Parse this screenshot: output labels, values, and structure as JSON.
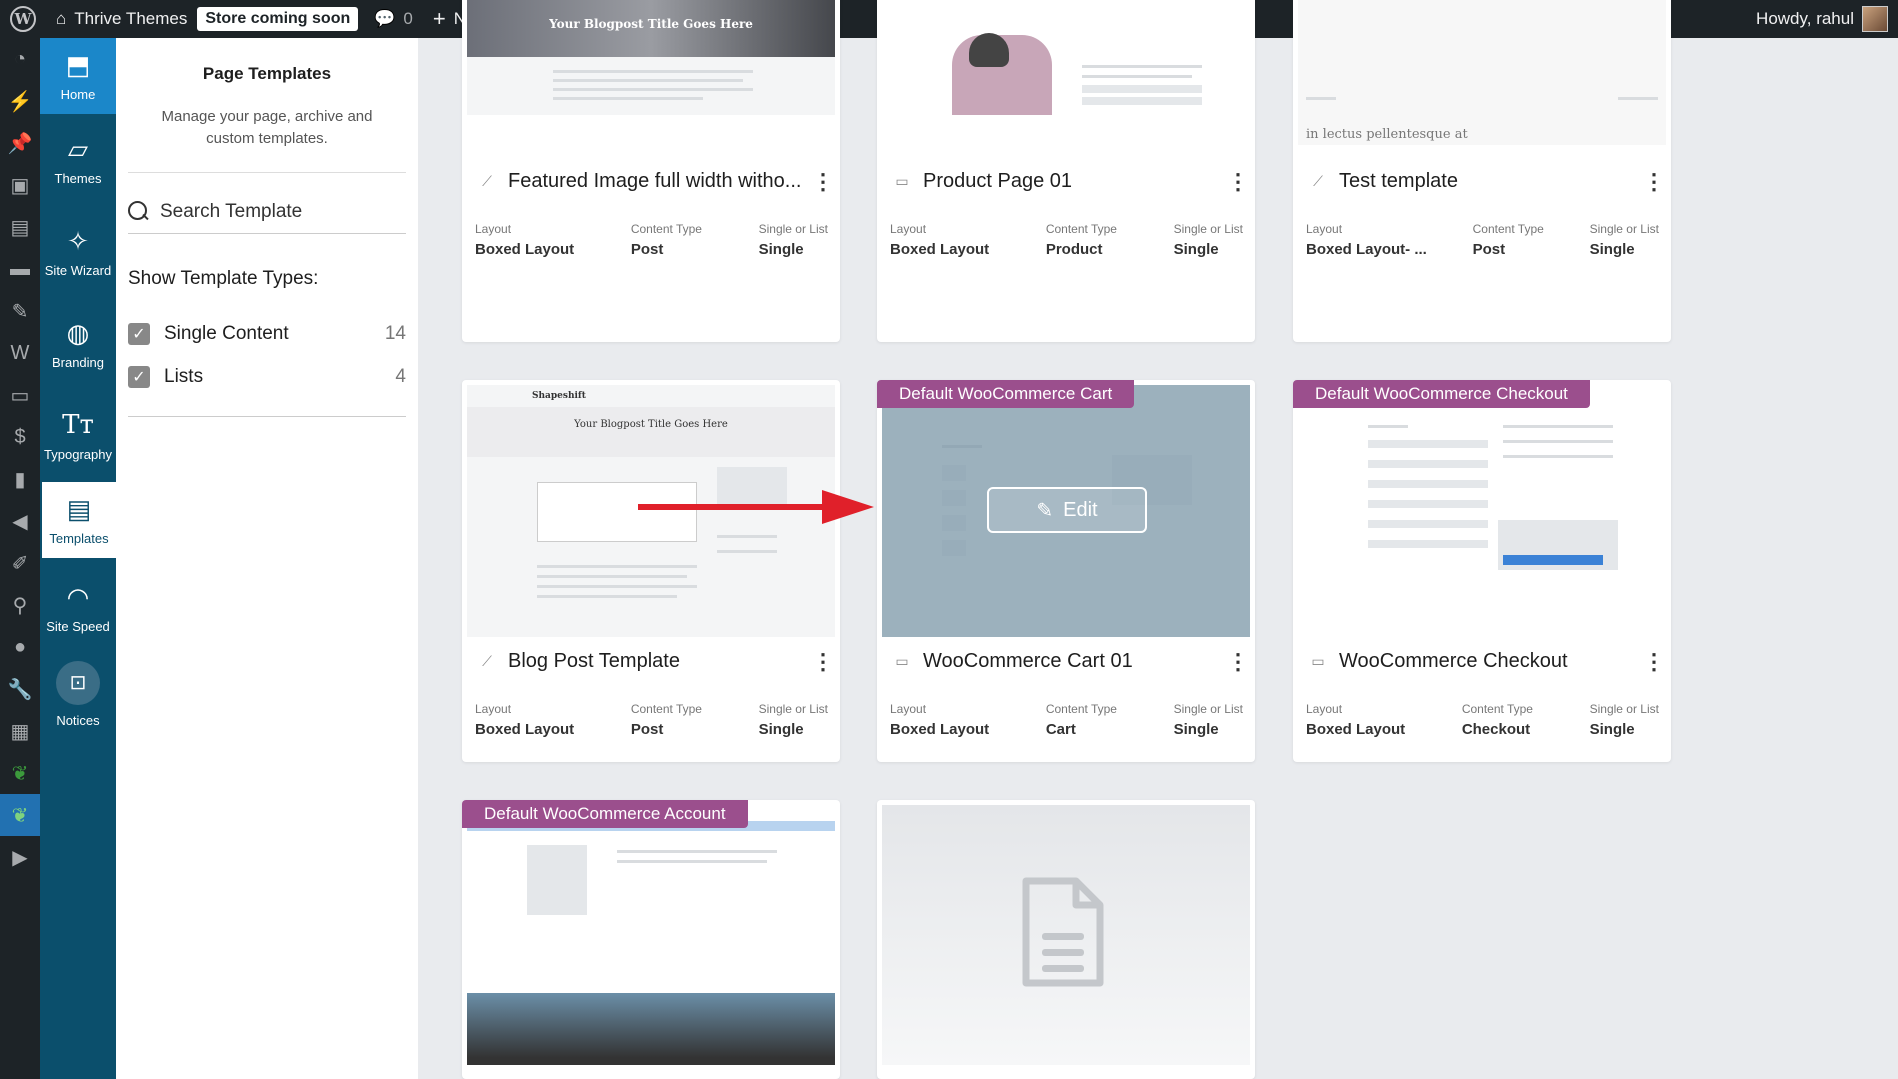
{
  "adminbar": {
    "site_name": "Thrive Themes",
    "status_badge": "Store coming soon",
    "comments_count": "0",
    "new_label": "New",
    "greeting": "Howdy, rahul"
  },
  "thrive_nav": [
    {
      "label": "Home",
      "icon": "home-icon"
    },
    {
      "label": "Themes",
      "icon": "themes-icon"
    },
    {
      "label": "Site Wizard",
      "icon": "wand-icon"
    },
    {
      "label": "Branding",
      "icon": "palette-icon"
    },
    {
      "label": "Typography",
      "icon": "typography-icon"
    },
    {
      "label": "Templates",
      "icon": "templates-icon"
    },
    {
      "label": "Site Speed",
      "icon": "speedometer-icon"
    },
    {
      "label": "Notices",
      "icon": "inbox-icon"
    }
  ],
  "panel": {
    "title": "Page Templates",
    "description": "Manage your page, archive and custom templates.",
    "search_placeholder": "Search Template",
    "types_heading": "Show Template Types:",
    "types": [
      {
        "label": "Single Content",
        "count": "14",
        "checked": true
      },
      {
        "label": "Lists",
        "count": "4",
        "checked": true
      }
    ]
  },
  "meta_labels": {
    "layout": "Layout",
    "content_type": "Content Type",
    "single_or_list": "Single or List"
  },
  "cards": [
    {
      "title": "Featured Image full width witho...",
      "layout": "Boxed Layout",
      "content_type": "Post",
      "single_or_list": "Single",
      "icon": "feather-icon",
      "thumb_heading": "Your Blogpost Title Goes Here"
    },
    {
      "title": "Product Page 01",
      "layout": "Boxed Layout",
      "content_type": "Product",
      "single_or_list": "Single",
      "icon": "woo-icon"
    },
    {
      "title": "Test template",
      "layout": "Boxed Layout- ...",
      "content_type": "Post",
      "single_or_list": "Single",
      "icon": "feather-icon",
      "thumb_text": "in lectus pellentesque at"
    },
    {
      "title": "Blog Post Template",
      "layout": "Boxed Layout",
      "content_type": "Post",
      "single_or_list": "Single",
      "icon": "feather-icon",
      "thumb_logo": "Shapeshift",
      "thumb_heading": "Your Blogpost Title Goes Here"
    },
    {
      "title": "WooCommerce Cart 01",
      "layout": "Boxed Layout",
      "content_type": "Cart",
      "single_or_list": "Single",
      "icon": "woo-icon",
      "tag": "Default WooCommerce Cart",
      "edit_label": "Edit"
    },
    {
      "title": "WooCommerce Checkout",
      "layout": "Boxed Layout",
      "content_type": "Checkout",
      "single_or_list": "Single",
      "icon": "woo-icon",
      "tag": "Default WooCommerce Checkout"
    },
    {
      "tag": "Default WooCommerce Account"
    },
    {
      "icon": "document-icon"
    }
  ],
  "colors": {
    "accent_tag": "#9b4f8d",
    "nav_bg": "#0b4f6c",
    "nav_home": "#1b87c9",
    "arrow": "#e0202a"
  }
}
